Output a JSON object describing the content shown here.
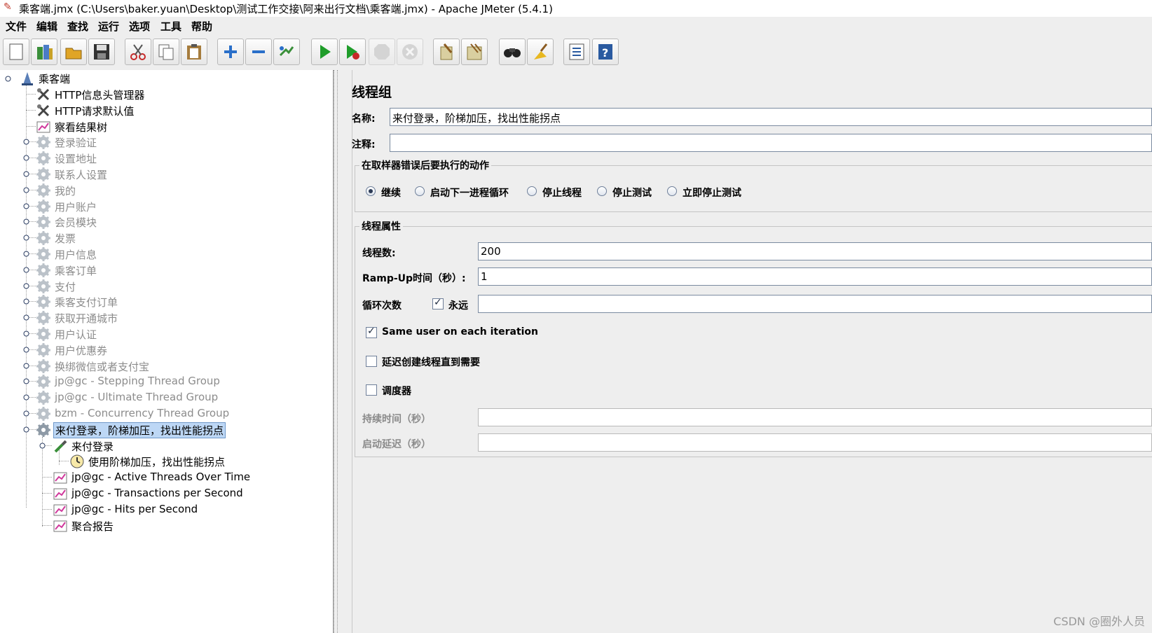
{
  "window": {
    "title": "乘客端.jmx (C:\\Users\\baker.yuan\\Desktop\\测试工作交接\\阿来出行文档\\乘客端.jmx) - Apache JMeter (5.4.1)"
  },
  "menu": [
    "文件",
    "编辑",
    "查找",
    "运行",
    "选项",
    "工具",
    "帮助"
  ],
  "toolbar": {
    "buttons": [
      "new-icon",
      "templates-icon",
      "open-icon",
      "save-icon",
      "cut-icon",
      "copy-icon",
      "paste-icon",
      "expand-icon",
      "collapse-icon",
      "toggle-icon",
      "start-icon",
      "start-no-pauses-icon",
      "stop-icon",
      "shutdown-icon",
      "clear-icon",
      "clear-all-icon",
      "search-icon",
      "reset-search-icon",
      "function-helper-icon",
      "help-icon"
    ]
  },
  "tree": {
    "root": "乘客端",
    "items": [
      {
        "label": "HTTP信息头管理器",
        "icon": "wrench-icon",
        "disabled": false
      },
      {
        "label": "HTTP请求默认值",
        "icon": "wrench-icon",
        "disabled": false
      },
      {
        "label": "察看结果树",
        "icon": "graph-icon",
        "disabled": false
      },
      {
        "label": "登录验证",
        "icon": "gear-icon",
        "disabled": true
      },
      {
        "label": "设置地址",
        "icon": "gear-icon",
        "disabled": true
      },
      {
        "label": "联系人设置",
        "icon": "gear-icon",
        "disabled": true
      },
      {
        "label": "我的",
        "icon": "gear-icon",
        "disabled": true
      },
      {
        "label": "用户账户",
        "icon": "gear-icon",
        "disabled": true
      },
      {
        "label": "会员模块",
        "icon": "gear-icon",
        "disabled": true
      },
      {
        "label": "发票",
        "icon": "gear-icon",
        "disabled": true
      },
      {
        "label": "用户信息",
        "icon": "gear-icon",
        "disabled": true
      },
      {
        "label": "乘客订单",
        "icon": "gear-icon",
        "disabled": true
      },
      {
        "label": "支付",
        "icon": "gear-icon",
        "disabled": true
      },
      {
        "label": "乘客支付订单",
        "icon": "gear-icon",
        "disabled": true
      },
      {
        "label": "获取开通城市",
        "icon": "gear-icon",
        "disabled": true
      },
      {
        "label": "用户认证",
        "icon": "gear-icon",
        "disabled": true
      },
      {
        "label": "用户优惠券",
        "icon": "gear-icon",
        "disabled": true
      },
      {
        "label": "换绑微信或者支付宝",
        "icon": "gear-icon",
        "disabled": true
      },
      {
        "label": "jp@gc - Stepping Thread Group",
        "icon": "gear-icon",
        "disabled": true
      },
      {
        "label": "jp@gc - Ultimate Thread Group",
        "icon": "gear-icon",
        "disabled": true
      },
      {
        "label": "bzm - Concurrency Thread Group",
        "icon": "gear-icon",
        "disabled": true
      },
      {
        "label": "来付登录，阶梯加压，找出性能拐点",
        "icon": "gear-icon",
        "disabled": false,
        "selected": true
      }
    ],
    "children": [
      {
        "label": "来付登录",
        "icon": "pipette-icon"
      },
      {
        "label": "使用阶梯加压，找出性能拐点",
        "icon": "timer-icon"
      },
      {
        "label": "jp@gc - Active Threads Over Time",
        "icon": "graph-icon"
      },
      {
        "label": "jp@gc - Transactions per Second",
        "icon": "graph-icon"
      },
      {
        "label": "jp@gc - Hits per Second",
        "icon": "graph-icon"
      },
      {
        "label": "聚合报告",
        "icon": "graph-icon"
      }
    ]
  },
  "panel": {
    "heading": "线程组",
    "name_label": "名称:",
    "name_value": "来付登录，阶梯加压，找出性能拐点",
    "comment_label": "注释:",
    "comment_value": "",
    "error_action": {
      "legend": "在取样器错误后要执行的动作",
      "options": [
        "继续",
        "启动下一进程循环",
        "停止线程",
        "停止测试",
        "立即停止测试"
      ],
      "selected": "继续"
    },
    "props": {
      "legend": "线程属性",
      "threads_label": "线程数:",
      "threads_value": "200",
      "rampup_label": "Ramp-Up时间（秒）:",
      "rampup_value": "1",
      "loop_label": "循环次数",
      "forever_label": "永远",
      "forever_checked": true,
      "loop_value": "",
      "same_user_label": "Same user on each iteration",
      "same_user_checked": true,
      "delay_label": "延迟创建线程直到需要",
      "delay_checked": false,
      "scheduler_label": "调度器",
      "scheduler_checked": false,
      "duration_label": "持续时间（秒）",
      "duration_value": "",
      "startup_label": "启动延迟（秒）",
      "startup_value": ""
    }
  },
  "watermark": "CSDN @圈外人员"
}
